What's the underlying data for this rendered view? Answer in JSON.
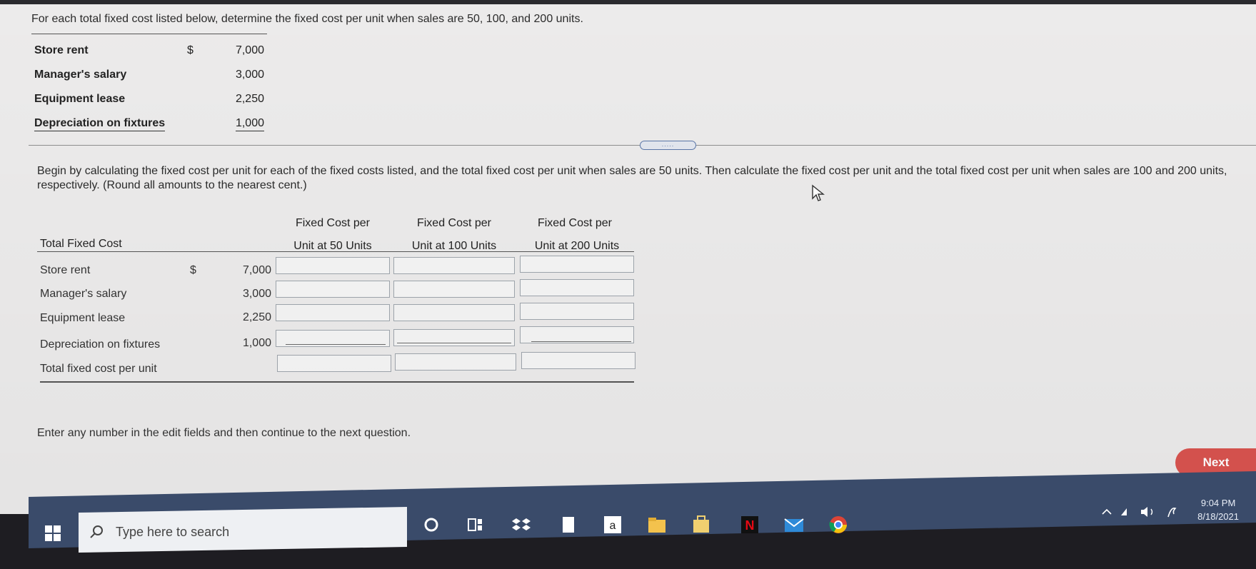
{
  "prompt": "For each total fixed cost listed below, determine the fixed cost per unit when sales are 50, 100, and 200 units.",
  "given": {
    "currency": "$",
    "rows": [
      {
        "label": "Store rent",
        "value": "7,000"
      },
      {
        "label": "Manager's salary",
        "value": "3,000"
      },
      {
        "label": "Equipment lease",
        "value": "2,250"
      },
      {
        "label": "Depreciation on fixtures",
        "value": "1,000"
      }
    ]
  },
  "divider_handle": ".....",
  "instructions": "Begin by calculating the fixed cost per unit for each of the fixed costs listed, and the total fixed cost per unit when sales are 50 units. Then calculate the fixed cost per unit and the total fixed cost per unit when sales are 100 and 200 units, respectively. (Round all amounts to the nearest cent.)",
  "table": {
    "total_header": "Total Fixed Cost",
    "col1_line1": "Fixed Cost per",
    "col1_line2": "Unit at 50 Units",
    "col2_line1": "Fixed Cost per",
    "col2_line2": "Unit at 100 Units",
    "col3_line1": "Fixed Cost per",
    "col3_line2": "Unit at 200 Units",
    "currency": "$",
    "rows": [
      {
        "label": "Store rent",
        "value": "7,000"
      },
      {
        "label": "Manager's salary",
        "value": "3,000"
      },
      {
        "label": "Equipment lease",
        "value": "2,250"
      },
      {
        "label": "Depreciation on fixtures",
        "value": "1,000"
      }
    ],
    "total_label": "Total fixed cost per unit"
  },
  "footer_note": "Enter any number in the edit fields and then continue to the next question.",
  "next_label": "Next",
  "taskbar": {
    "search_placeholder": "Type here to search",
    "time": "9:04 PM",
    "date": "8/18/2021"
  }
}
